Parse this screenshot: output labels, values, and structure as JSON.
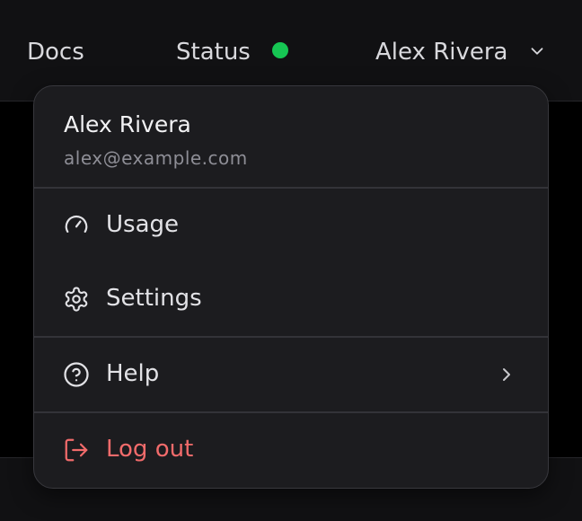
{
  "topbar": {
    "docs_label": "Docs",
    "status_label": "Status",
    "status_color": "#16c653",
    "user_label": "Alex Rivera",
    "chevron_icon": "chevron-down-icon"
  },
  "dropdown": {
    "user": {
      "name": "Alex Rivera",
      "email": "alex@example.com"
    },
    "items": [
      {
        "label": "Usage",
        "icon": "gauge-icon"
      },
      {
        "label": "Settings",
        "icon": "gear-icon"
      },
      {
        "label": "Help",
        "icon": "help-circle-icon",
        "submenu_icon": "chevron-right-icon"
      },
      {
        "label": "Log out",
        "icon": "logout-icon",
        "color": "#f26b6b"
      }
    ]
  }
}
